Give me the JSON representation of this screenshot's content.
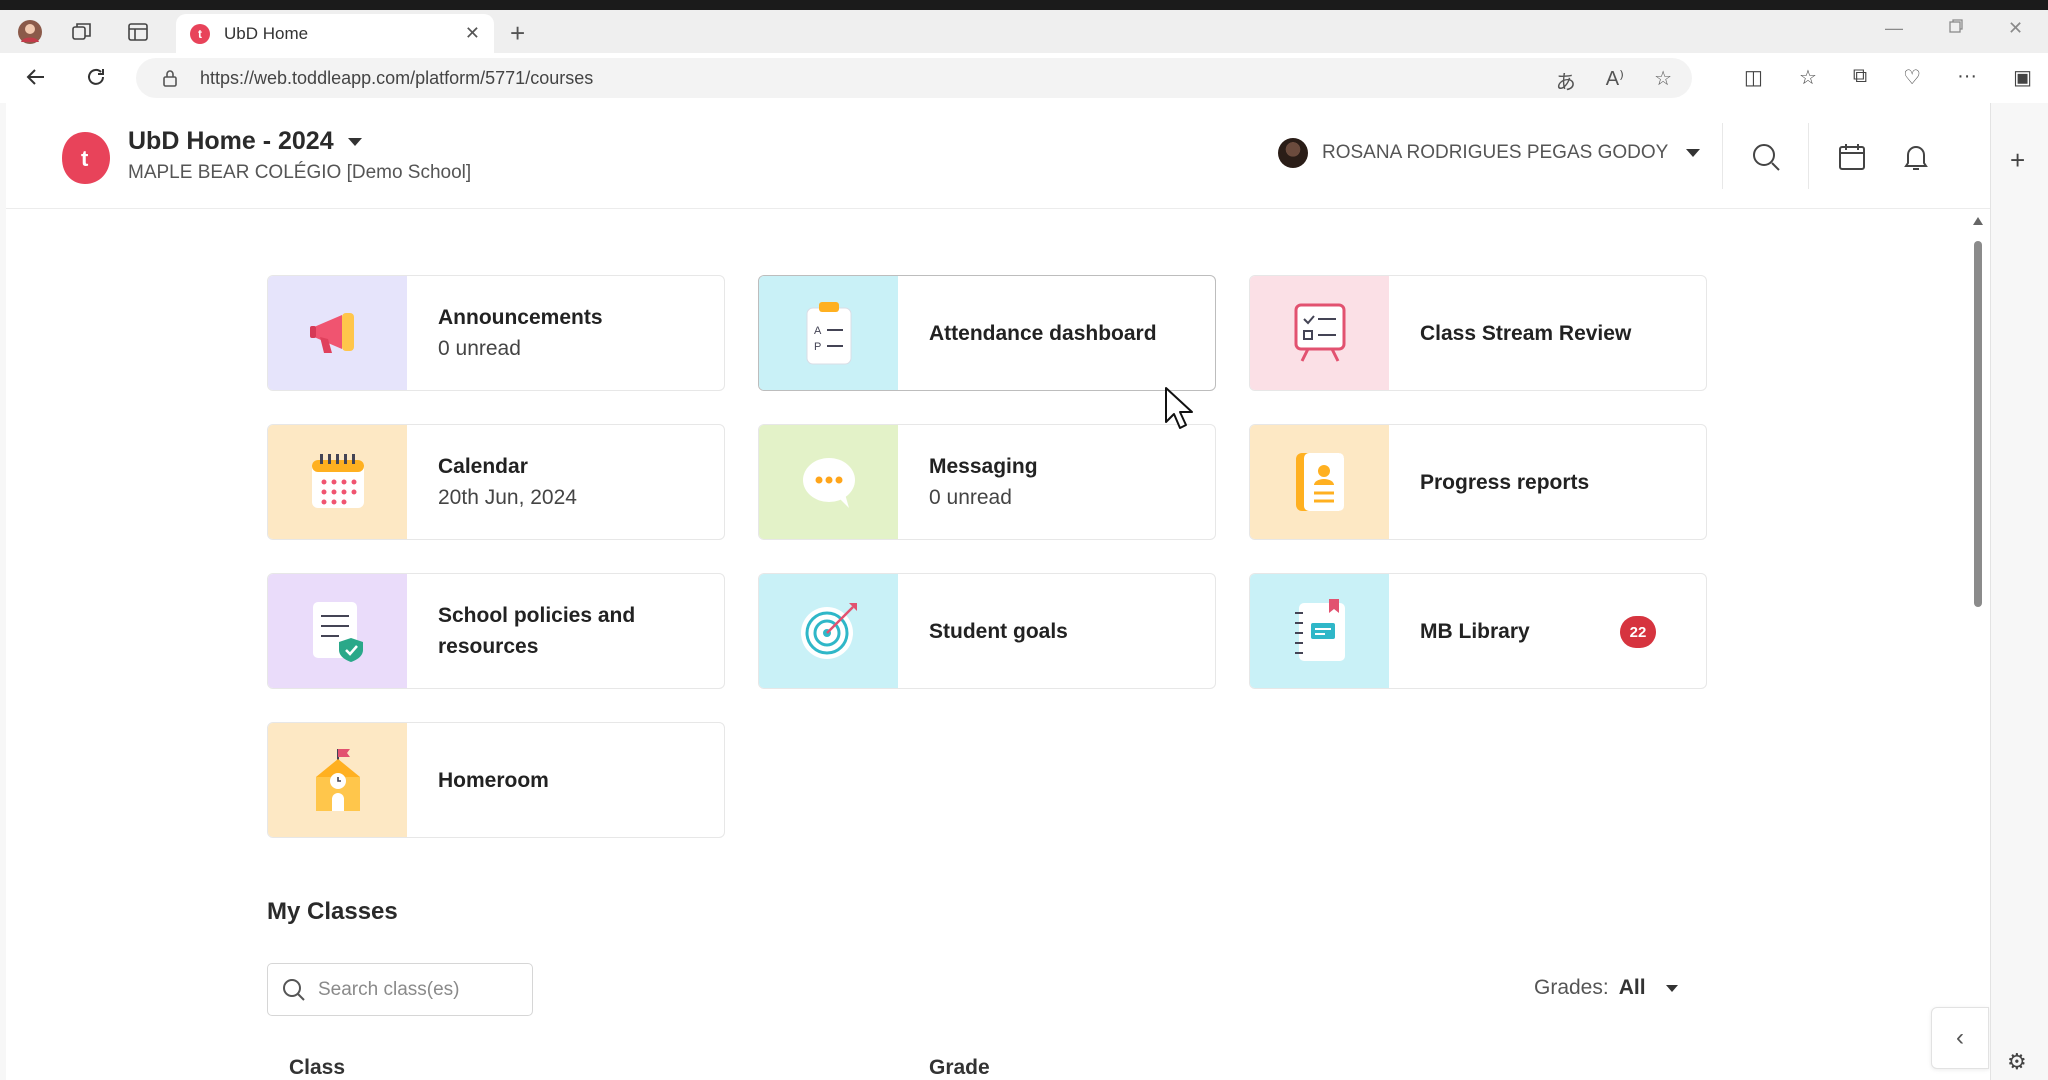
{
  "browser": {
    "tab_title": "UbD Home",
    "url": "https://web.toddleapp.com/platform/5771/courses"
  },
  "header": {
    "logo_letter": "t",
    "workspace_title": "UbD Home - 2024",
    "school_name": "MAPLE BEAR COLÉGIO [Demo School]",
    "user_name": "ROSANA RODRIGUES PEGAS GODOY"
  },
  "tiles": [
    {
      "title": "Announcements",
      "subtitle": "0 unread",
      "icon": "megaphone-icon",
      "bg": "#e6e4fb"
    },
    {
      "title": "Attendance dashboard",
      "subtitle": "",
      "icon": "clipboard-icon",
      "bg": "#c9f1f7"
    },
    {
      "title": "Class Stream Review",
      "subtitle": "",
      "icon": "checklist-board-icon",
      "bg": "#fbe0e6"
    },
    {
      "title": "Calendar",
      "subtitle": "20th Jun, 2024",
      "icon": "calendar-icon",
      "bg": "#fde8c4"
    },
    {
      "title": "Messaging",
      "subtitle": "0 unread",
      "icon": "chat-bubble-icon",
      "bg": "#e3f2c8"
    },
    {
      "title": "Progress reports",
      "subtitle": "",
      "icon": "report-book-icon",
      "bg": "#fde8c4"
    },
    {
      "title": "School policies and resources",
      "subtitle": "",
      "icon": "policy-document-icon",
      "bg": "#eadcfa"
    },
    {
      "title": "Student goals",
      "subtitle": "",
      "icon": "target-icon",
      "bg": "#c9f1f7"
    },
    {
      "title": "MB Library",
      "subtitle": "",
      "icon": "notebook-icon",
      "bg": "#c9f1f7",
      "badge": "22"
    },
    {
      "title": "Homeroom",
      "subtitle": "",
      "icon": "school-building-icon",
      "bg": "#fde8c4"
    }
  ],
  "my_classes": {
    "title": "My Classes",
    "search_placeholder": "Search class(es)",
    "grades_label": "Grades:",
    "grades_value": "All",
    "columns": [
      "Class",
      "Grade"
    ]
  },
  "colors": {
    "brand": "#e8435a",
    "badge": "#d6343f"
  }
}
